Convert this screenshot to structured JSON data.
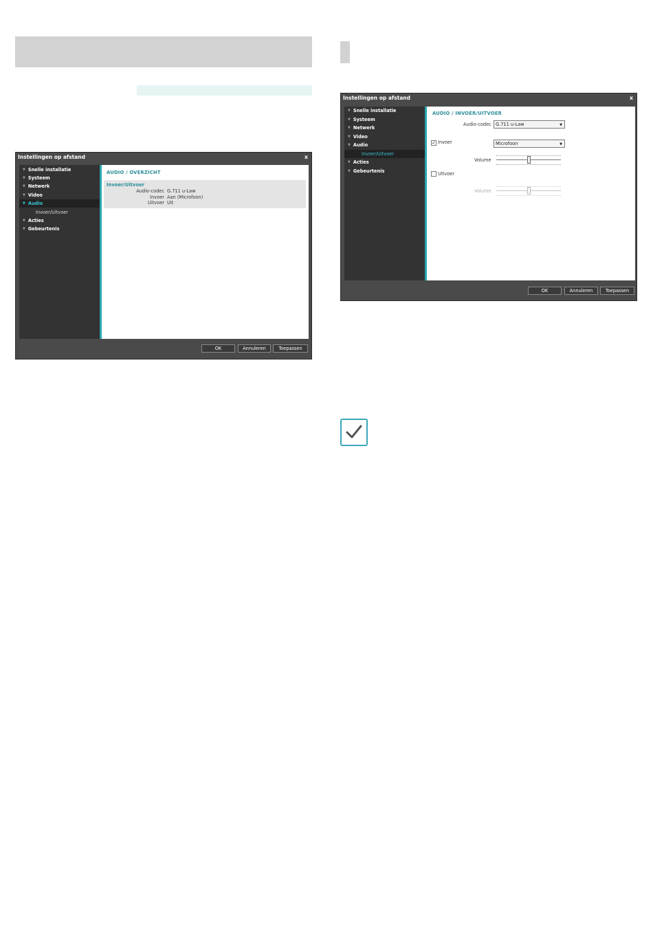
{
  "colors": {
    "accent": "#2aa6b0",
    "accent_text": "#3ac4d0",
    "dialog_bg": "#4a4a4a",
    "sidebar_bg": "#333333",
    "header_band": "#d2d2d2",
    "stripe": "#e6f4f4",
    "note_border": "#3aa7b8"
  },
  "note_icon": "checkmark-icon",
  "dialog_overview": {
    "title": "Instellingen op afstand",
    "close_label": "x",
    "nav": [
      {
        "label": "Snelle installatie"
      },
      {
        "label": "Systeem"
      },
      {
        "label": "Netwerk"
      },
      {
        "label": "Video"
      },
      {
        "label": "Audio"
      },
      {
        "label": "Invoer/Uitvoer"
      },
      {
        "label": "Acties"
      },
      {
        "label": "Gebeurtenis"
      }
    ],
    "section_title": "AUDIO / OVERZICHT",
    "box_title": "Invoer/Uitvoer",
    "rows": [
      {
        "label": "Audio-codec",
        "value": "G.711 u-Law"
      },
      {
        "label": "Invoer",
        "value": "Aan (Microfoon)"
      },
      {
        "label": "Uitvoer",
        "value": "Uit"
      }
    ],
    "buttons": {
      "ok": "OK",
      "cancel": "Annuleren",
      "apply": "Toepassen"
    }
  },
  "dialog_io": {
    "title": "Instellingen op afstand",
    "close_label": "x",
    "nav": [
      {
        "label": "Snelle installatie"
      },
      {
        "label": "Systeem"
      },
      {
        "label": "Netwerk"
      },
      {
        "label": "Video"
      },
      {
        "label": "Audio"
      },
      {
        "label": "Invoer/Uitvoer"
      },
      {
        "label": "Acties"
      },
      {
        "label": "Gebeurtenis"
      }
    ],
    "section_title": "AUDIO / INVOER/UITVOER",
    "codec_label": "Audio-codec",
    "codec_value": "G.711 u-Law",
    "input_label": "Invoer",
    "input_checked": true,
    "check_mark": "✓",
    "input_source": "Microfoon",
    "input_volume_label": "Volume",
    "input_volume_level": 0.5,
    "output_label": "Uitvoer",
    "output_checked": false,
    "output_volume_label": "Volume",
    "output_volume_level": 0.5,
    "buttons": {
      "ok": "OK",
      "cancel": "Annuleren",
      "apply": "Toepassen"
    }
  }
}
